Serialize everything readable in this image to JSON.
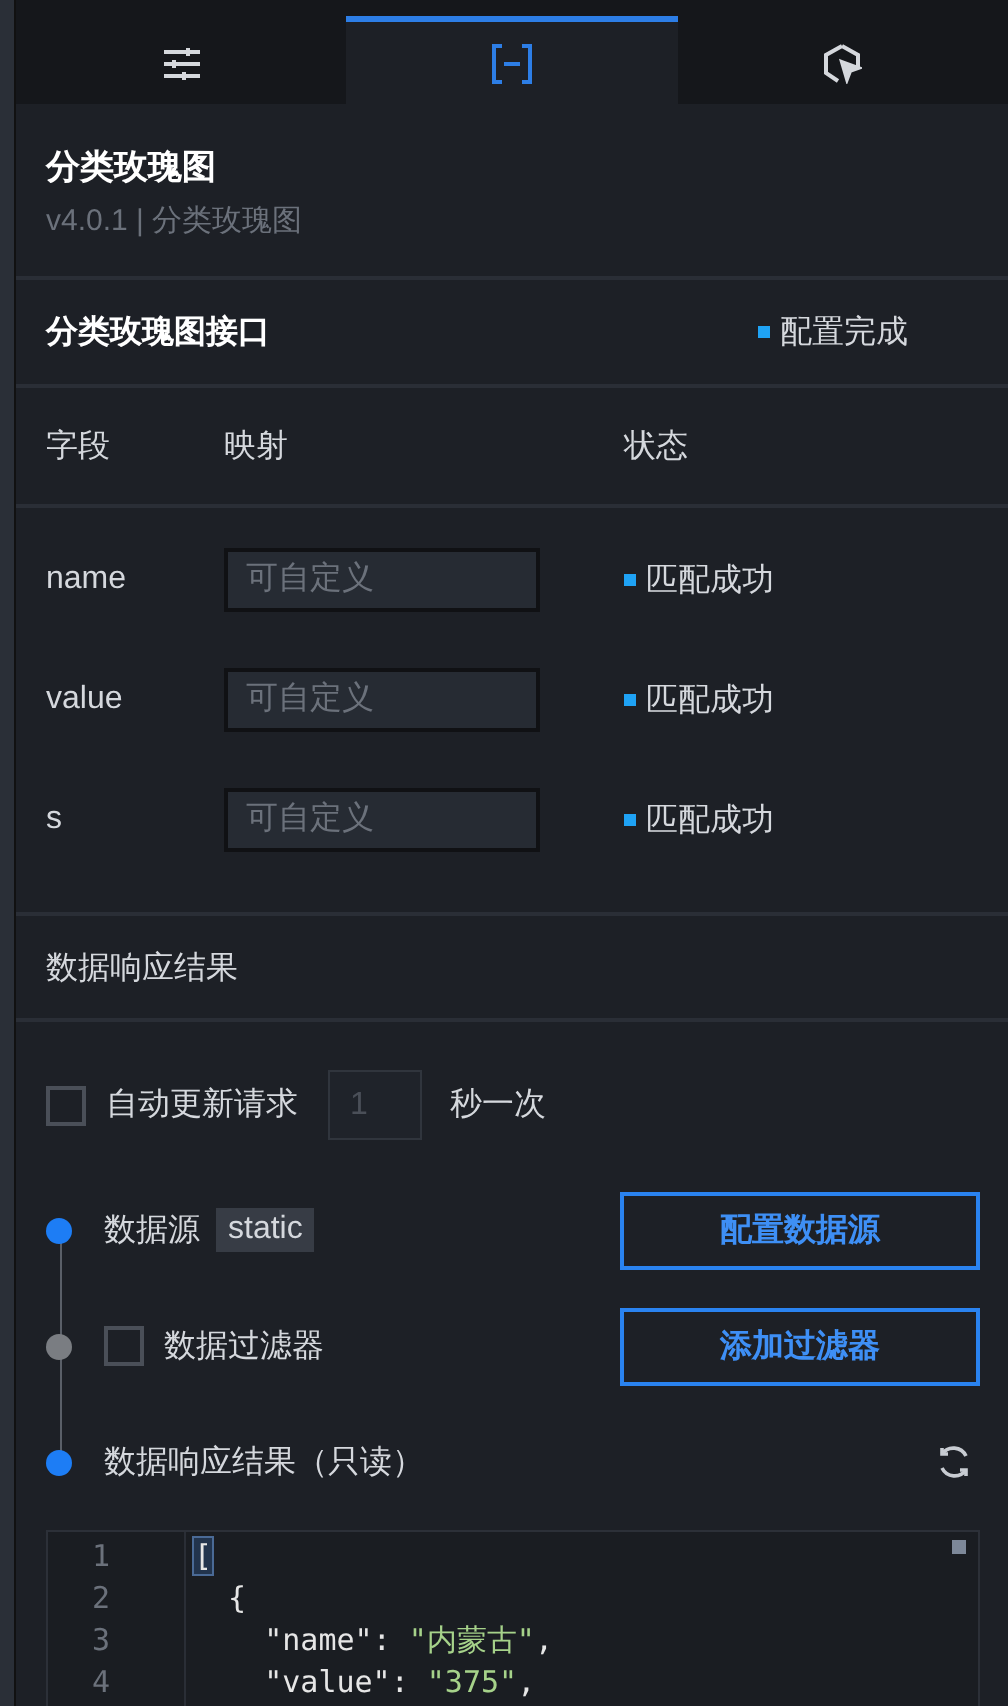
{
  "tabs": [
    {
      "kind": "sliders",
      "selected": false
    },
    {
      "kind": "brackets",
      "selected": true
    },
    {
      "kind": "pointer",
      "selected": false
    }
  ],
  "component": {
    "title": "分类玫瑰图",
    "version": "v4.0.1 | 分类玫瑰图"
  },
  "interface": {
    "title": "分类玫瑰图接口",
    "status": "配置完成"
  },
  "mapping": {
    "columns": [
      "字段",
      "映射",
      "状态"
    ],
    "rows": [
      {
        "field": "name",
        "placeholder": "可自定义",
        "status": "匹配成功"
      },
      {
        "field": "value",
        "placeholder": "可自定义",
        "status": "匹配成功"
      },
      {
        "field": "s",
        "placeholder": "可自定义",
        "status": "匹配成功"
      }
    ]
  },
  "response_title": "数据响应结果",
  "auto_update": {
    "checked": false,
    "label": "自动更新请求",
    "placeholder": "1",
    "unit": "秒一次"
  },
  "steps": [
    {
      "kind": "source",
      "active": true,
      "label": "数据源",
      "tag": "static",
      "button": "配置数据源"
    },
    {
      "kind": "filter",
      "active": false,
      "checked": false,
      "label": "数据过滤器",
      "button": "添加过滤器"
    },
    {
      "kind": "result",
      "active": true,
      "label": "数据响应结果（只读）"
    }
  ],
  "code": [
    {
      "num": "1",
      "text": "[",
      "kind": "bracket"
    },
    {
      "num": "2",
      "text": "  {",
      "kind": "plain"
    },
    {
      "num": "3",
      "key": "\"name\"",
      "sep": ": ",
      "value": "\"内蒙古\"",
      "end": ",",
      "kind": "pair"
    },
    {
      "num": "4",
      "key": "\"value\"",
      "sep": ": ",
      "value": "\"375\"",
      "end": ",",
      "kind": "pair"
    }
  ]
}
